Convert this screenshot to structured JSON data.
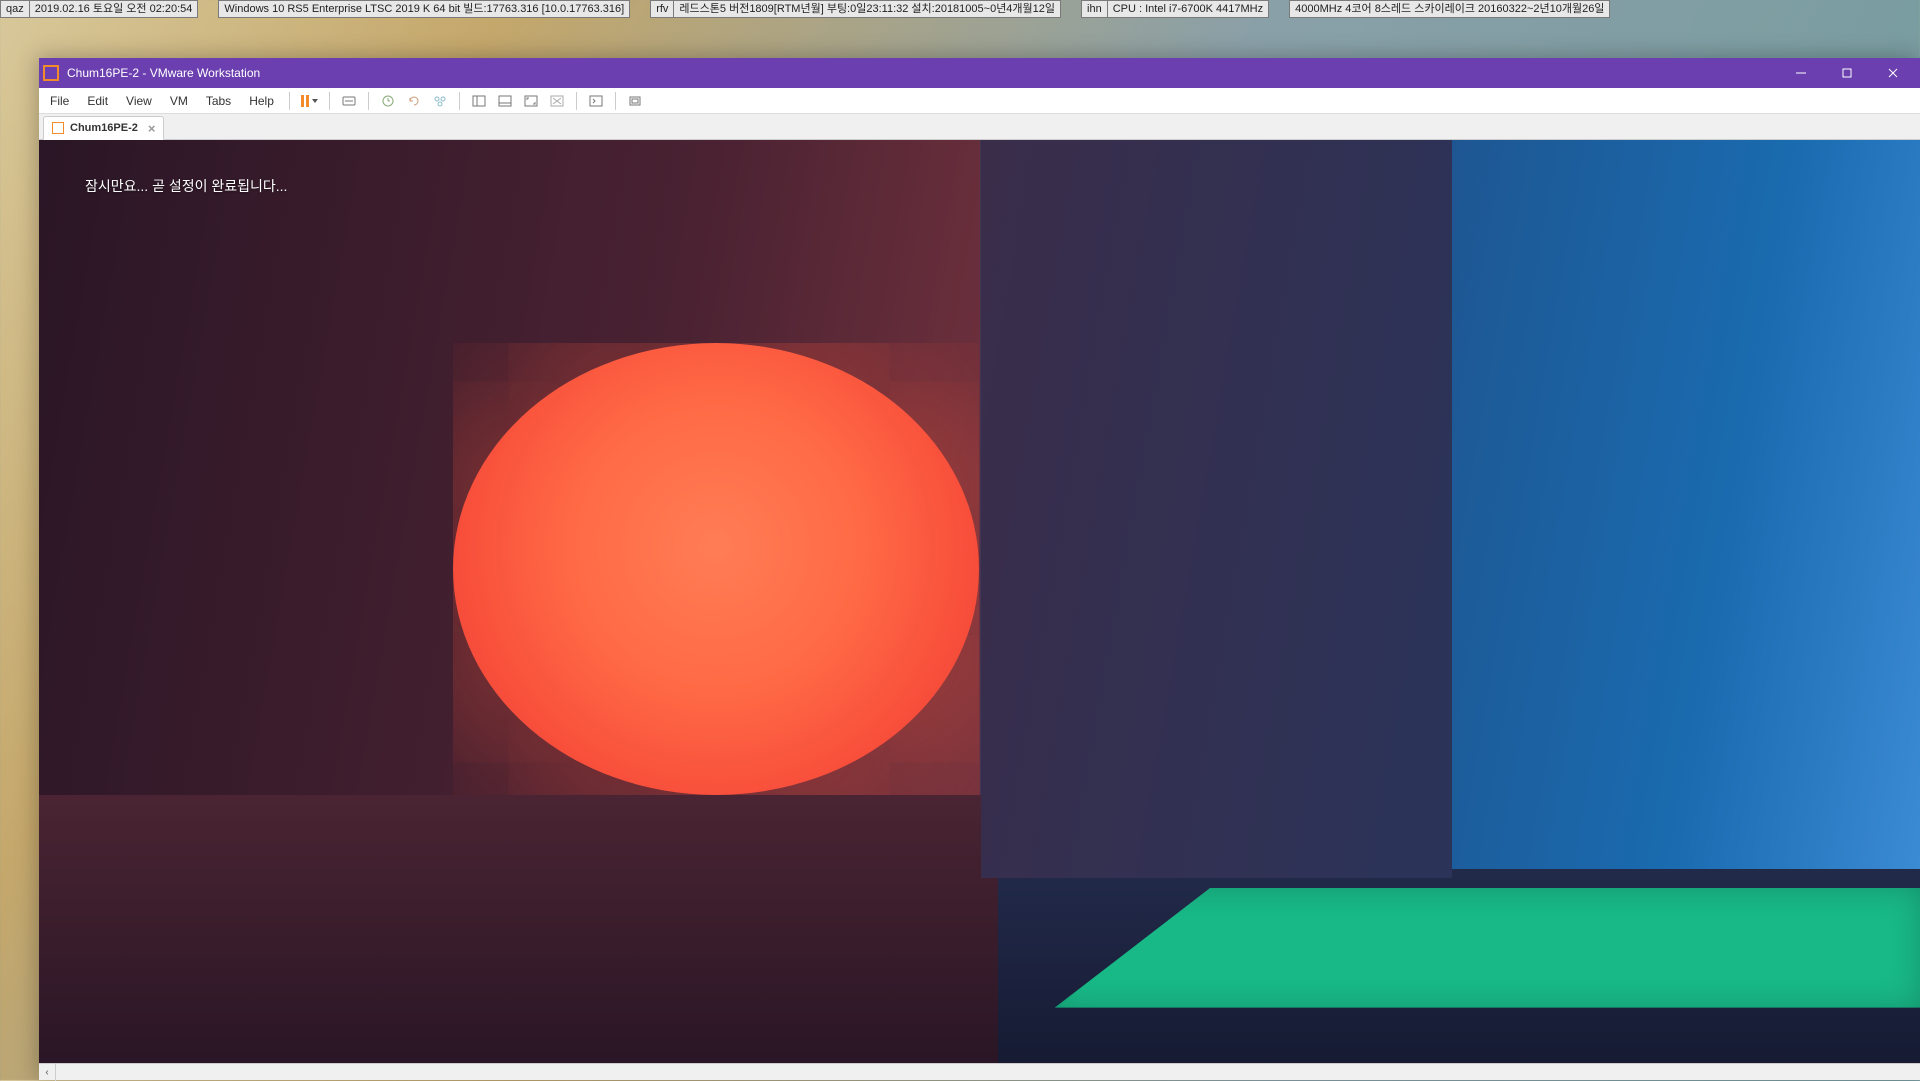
{
  "desktop_info": {
    "group1": {
      "label": "qaz",
      "value": "2019.02.16 토요일 오전 02:20:54"
    },
    "group2": {
      "value": "Windows 10 RS5 Enterprise LTSC 2019 K 64 bit 빌드:17763.316 [10.0.17763.316]"
    },
    "group3": {
      "label": "rfv",
      "value": "레드스톤5 버전1809[RTM년월] 부팅:0일23:11:32 설치:20181005~0년4개월12일"
    },
    "group4": {
      "label": "ihn",
      "value": "CPU : Intel i7-6700K 4417MHz"
    },
    "group5": {
      "value": "4000MHz 4코어 8스레드 스카이레이크 20160322~2년10개월26일"
    }
  },
  "window": {
    "title": "Chum16PE-2 - VMware Workstation"
  },
  "menu": {
    "file": "File",
    "edit": "Edit",
    "view": "View",
    "vm": "VM",
    "tabs": "Tabs",
    "help": "Help"
  },
  "tab": {
    "name": "Chum16PE-2"
  },
  "guest": {
    "oobe_message": "잠시만요... 곧 설정이 완료됩니다..."
  }
}
